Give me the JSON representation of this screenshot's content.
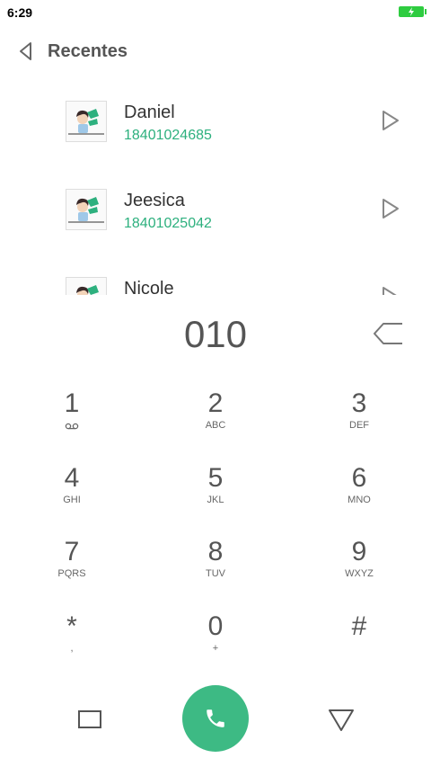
{
  "status_bar": {
    "time": "6:29"
  },
  "header": {
    "title": "Recentes"
  },
  "recents": [
    {
      "name": "Daniel",
      "number": "18401024685"
    },
    {
      "name": "Jeesica",
      "number": "18401025042"
    },
    {
      "name": "Nicole",
      "number": ""
    }
  ],
  "dialer": {
    "dialed_number": "010"
  },
  "keypad": [
    {
      "digit": "1",
      "sub": ""
    },
    {
      "digit": "2",
      "sub": "ABC"
    },
    {
      "digit": "3",
      "sub": "DEF"
    },
    {
      "digit": "4",
      "sub": "GHI"
    },
    {
      "digit": "5",
      "sub": "JKL"
    },
    {
      "digit": "6",
      "sub": "MNO"
    },
    {
      "digit": "7",
      "sub": "PQRS"
    },
    {
      "digit": "8",
      "sub": "TUV"
    },
    {
      "digit": "9",
      "sub": "WXYZ"
    },
    {
      "digit": "*",
      "sub": ","
    },
    {
      "digit": "0",
      "sub": "+"
    },
    {
      "digit": "#",
      "sub": ""
    }
  ],
  "colors": {
    "accent": "#3dba84",
    "number_text": "#2db07e",
    "battery": "#2ecc40"
  },
  "icons": {
    "back": "back-triangle-icon",
    "play": "play-outline-icon",
    "backspace": "backspace-icon",
    "voicemail": "voicemail-icon",
    "call": "phone-icon",
    "nav_recent": "square-icon",
    "nav_hide": "triangle-down-icon"
  }
}
